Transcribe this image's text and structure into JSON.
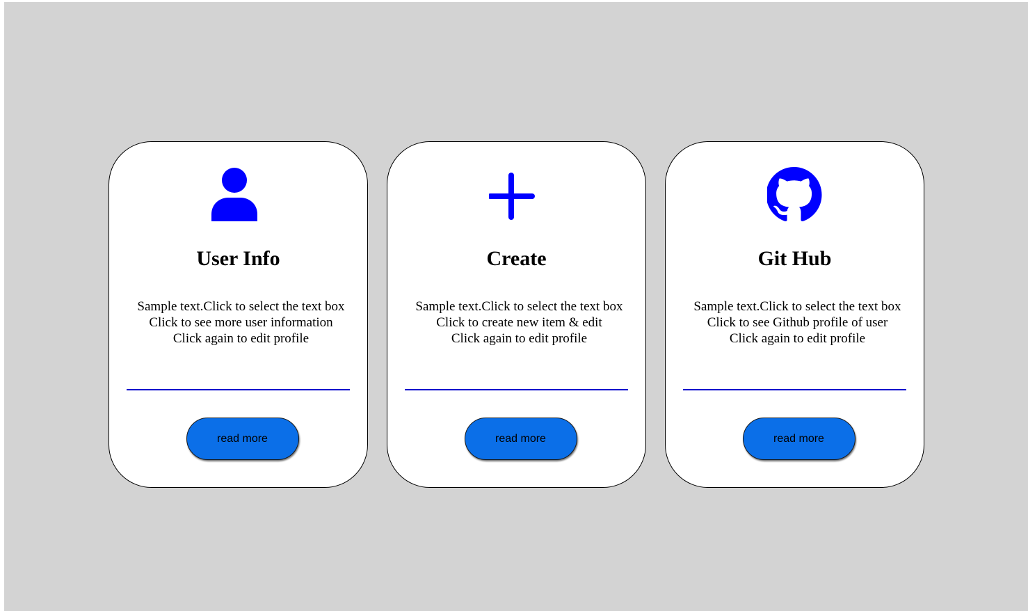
{
  "colors": {
    "background": "#d3d3d3",
    "card": "#ffffff",
    "icon": "#0000ff",
    "divider": "#0000cc",
    "button": "#0b6fe8"
  },
  "cards": [
    {
      "icon": "user-icon",
      "title": "User Info",
      "lines": [
        "Sample text.Click to select the text box",
        "Click to see more user information",
        "Click again to edit profile"
      ],
      "button_label": "read more"
    },
    {
      "icon": "plus-icon",
      "title": "Create",
      "lines": [
        "Sample text.Click to select the text box",
        "Click to create new item & edit",
        "Click again to edit profile"
      ],
      "button_label": "read more"
    },
    {
      "icon": "github-icon",
      "title": "Git Hub",
      "lines": [
        "Sample text.Click to select the text box",
        "Click to see Github profile of user",
        "Click again to edit profile"
      ],
      "button_label": "read more"
    }
  ]
}
